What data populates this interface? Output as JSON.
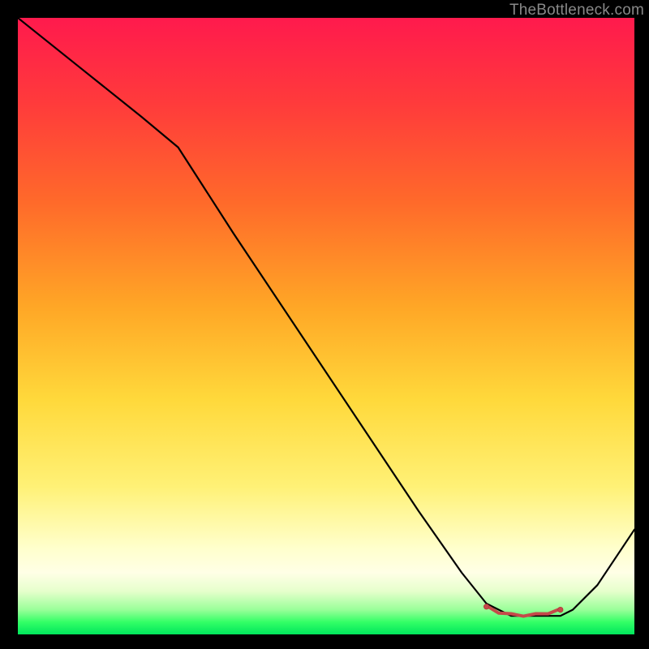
{
  "watermark": "TheBottleneck.com",
  "colors": {
    "line": "#000000",
    "marker": "#c44a4a",
    "marker_stroke": "#b03838",
    "background": "#000000"
  },
  "chart_data": {
    "type": "line",
    "title": "",
    "xlabel": "",
    "ylabel": "",
    "xlim": [
      0,
      100
    ],
    "ylim": [
      0,
      100
    ],
    "grid": false,
    "legend": false,
    "series": [
      {
        "name": "curve",
        "x": [
          0,
          10,
          20,
          26,
          35,
          45,
          55,
          65,
          72,
          76,
          80,
          84,
          88,
          90,
          94,
          100
        ],
        "values": [
          100,
          92,
          84,
          79,
          65,
          50,
          35,
          20,
          10,
          5,
          3,
          3,
          3,
          4,
          8,
          17
        ]
      }
    ],
    "markers": {
      "x": [
        76,
        78,
        80,
        82,
        84,
        86,
        88
      ],
      "values": [
        4.5,
        3.6,
        3.2,
        3.1,
        3.2,
        3.5,
        4.0
      ],
      "style": "wavy-dash"
    }
  }
}
